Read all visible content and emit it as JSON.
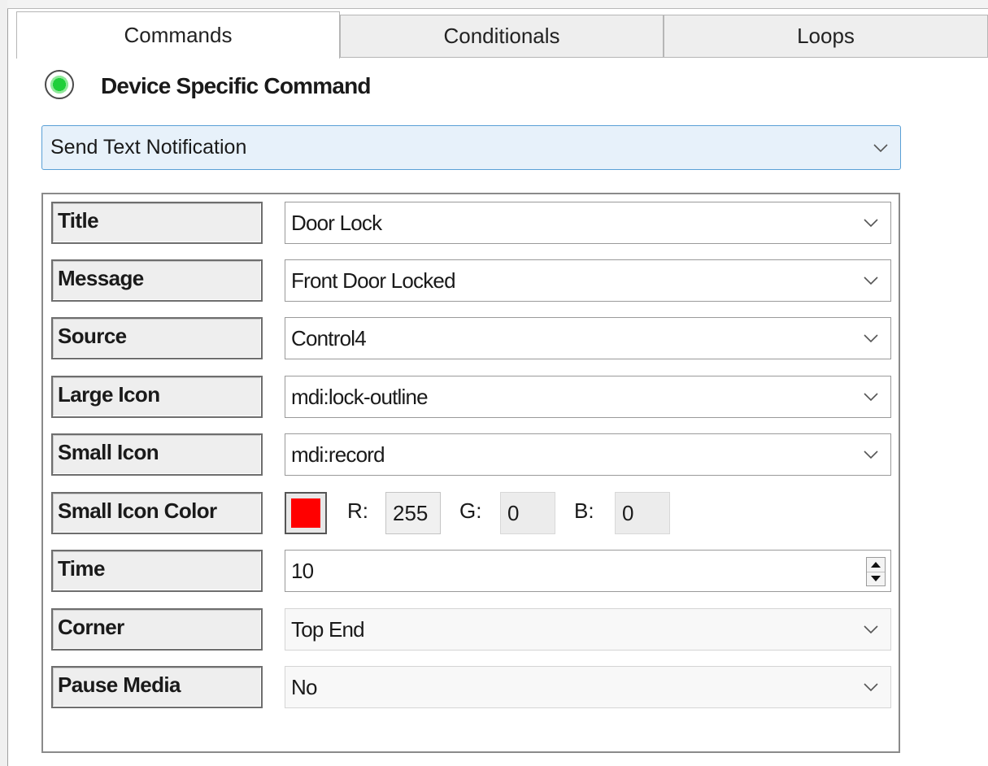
{
  "tabs": [
    {
      "label": "Commands",
      "active": true
    },
    {
      "label": "Conditionals",
      "active": false
    },
    {
      "label": "Loops",
      "active": false
    }
  ],
  "radio": {
    "label": "Device Specific Command",
    "checked": true
  },
  "command": {
    "selected": "Send Text Notification"
  },
  "fields": {
    "title": {
      "label": "Title",
      "value": "Door Lock"
    },
    "message": {
      "label": "Message",
      "value": "Front Door Locked"
    },
    "source": {
      "label": "Source",
      "value": "Control4"
    },
    "large_icon": {
      "label": "Large Icon",
      "value": "mdi:lock-outline"
    },
    "small_icon": {
      "label": "Small Icon",
      "value": "mdi:record"
    },
    "small_icon_color": {
      "label": "Small Icon Color",
      "swatch_color": "#ff0000",
      "r_label": "R:",
      "r": "255",
      "g_label": "G:",
      "g": "0",
      "b_label": "B:",
      "b": "0"
    },
    "time": {
      "label": "Time",
      "value": "10"
    },
    "corner": {
      "label": "Corner",
      "value": "Top End"
    },
    "pause_media": {
      "label": "Pause Media",
      "value": "No"
    }
  },
  "icons": {
    "dropdown": "chevron-down-icon",
    "spinner_up": "spinner-up-icon",
    "spinner_down": "spinner-down-icon"
  }
}
